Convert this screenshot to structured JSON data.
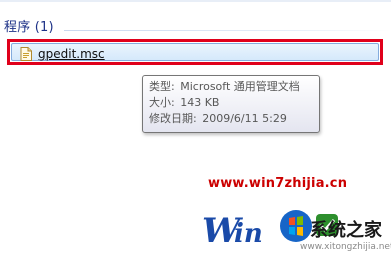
{
  "section": {
    "title": "程序 (1)"
  },
  "results": [
    {
      "name": "gpedit.msc",
      "icon": "msc-file-icon"
    }
  ],
  "tooltip": {
    "type_label": "类型:",
    "type_value": "Microsoft 通用管理文档",
    "size_label": "大小:",
    "size_value": "143 KB",
    "modified_label": "修改日期:",
    "modified_value": "2009/6/11 5:29"
  },
  "watermark": {
    "url": "www.win7zhijia.cn",
    "brand": "系统之家",
    "site": "www.xitongzhijia.net"
  },
  "colors": {
    "highlight_border": "#e0001b",
    "section_title": "#1e3287",
    "watermark_url": "#cc0000"
  }
}
